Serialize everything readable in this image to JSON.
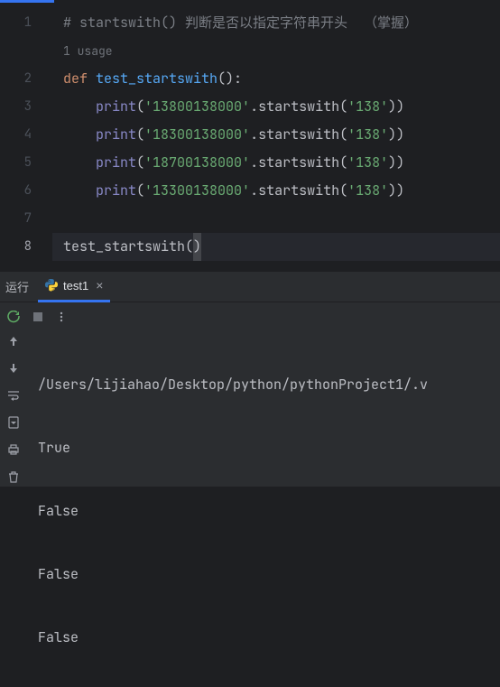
{
  "editor": {
    "lines": {
      "l1_comment": "# startswith() 判断是否以指定字符串开头  （掌握）",
      "usage_hint": "1 usage",
      "l2": {
        "def": "def",
        "space": " ",
        "name": "test_startswith",
        "tail": "():"
      },
      "l3": {
        "indent": "    ",
        "fn": "print",
        "p1": "(",
        "s1": "'13800138000'",
        "dot": ".",
        "m": "startswith",
        "p2": "(",
        "s2": "'138'",
        "p3": "))"
      },
      "l4": {
        "indent": "    ",
        "fn": "print",
        "p1": "(",
        "s1": "'18300138000'",
        "dot": ".",
        "m": "startswith",
        "p2": "(",
        "s2": "'138'",
        "p3": "))"
      },
      "l5": {
        "indent": "    ",
        "fn": "print",
        "p1": "(",
        "s1": "'18700138000'",
        "dot": ".",
        "m": "startswith",
        "p2": "(",
        "s2": "'138'",
        "p3": "))"
      },
      "l6": {
        "indent": "    ",
        "fn": "print",
        "p1": "(",
        "s1": "'13300138000'",
        "dot": ".",
        "m": "startswith",
        "p2": "(",
        "s2": "'138'",
        "p3": "))"
      },
      "l8": {
        "name": "test_startswith",
        "p1": "(",
        "p2": ")"
      }
    },
    "gutter": {
      "n1": "1",
      "n2": "2",
      "n3": "3",
      "n4": "4",
      "n5": "5",
      "n6": "6",
      "n7": "7",
      "n8": "8"
    }
  },
  "tool_window": {
    "title": "运行",
    "tab_label": "test1",
    "console": {
      "c1": "/Users/lijiahao/Desktop/python/pythonProject1/.v",
      "c2": "True",
      "c3": "False",
      "c4": "False",
      "c5": "False"
    }
  }
}
